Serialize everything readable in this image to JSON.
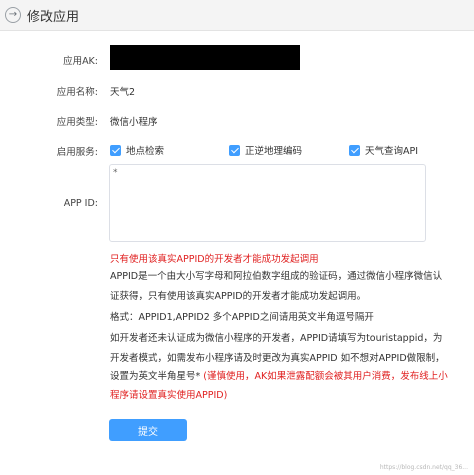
{
  "header": {
    "back_icon": "circle-arrow-right-icon",
    "title": "修改应用"
  },
  "form": {
    "app_ak": {
      "label": "应用AK:"
    },
    "app_name": {
      "label": "应用名称:",
      "value": "天气2"
    },
    "app_type": {
      "label": "应用类型:",
      "value": "微信小程序"
    },
    "app_services": {
      "label": "启用服务:",
      "items": [
        {
          "label": "地点检索",
          "checked": true
        },
        {
          "label": "正逆地理编码",
          "checked": true
        },
        {
          "label": "天气查询API",
          "checked": true
        }
      ]
    },
    "app_id": {
      "label": "APP ID:",
      "value": "*"
    }
  },
  "help": {
    "red_notice": "只有使用该真实APPID的开发者才能成功发起调用",
    "line1": "APPID是一个由大小写字母和阿拉伯数字组成的验证码，通过微信小程序微信认",
    "line2": "证获得，只有使用该真实APPID的开发者才能成功发起调用。",
    "line3": "格式：APPID1,APPID2 多个APPID之间请用英文半角逗号隔开",
    "line4": "如开发者还未认证成为微信小程序的开发者，APPID请填写为touristappid，为",
    "line5": "开发者模式，如需发布小程序请及时更改为真实APPID 如不想对APPID做限制，",
    "line6_normal": "设置为英文半角星号* ",
    "line6_red": "(谨慎使用，AK如果泄露配额会被其用户消费，发布线上小",
    "line7_red": "程序请设置真实使用APPID)"
  },
  "submit_label": "提交",
  "watermark": "https://blog.csdn.net/qq_36..."
}
